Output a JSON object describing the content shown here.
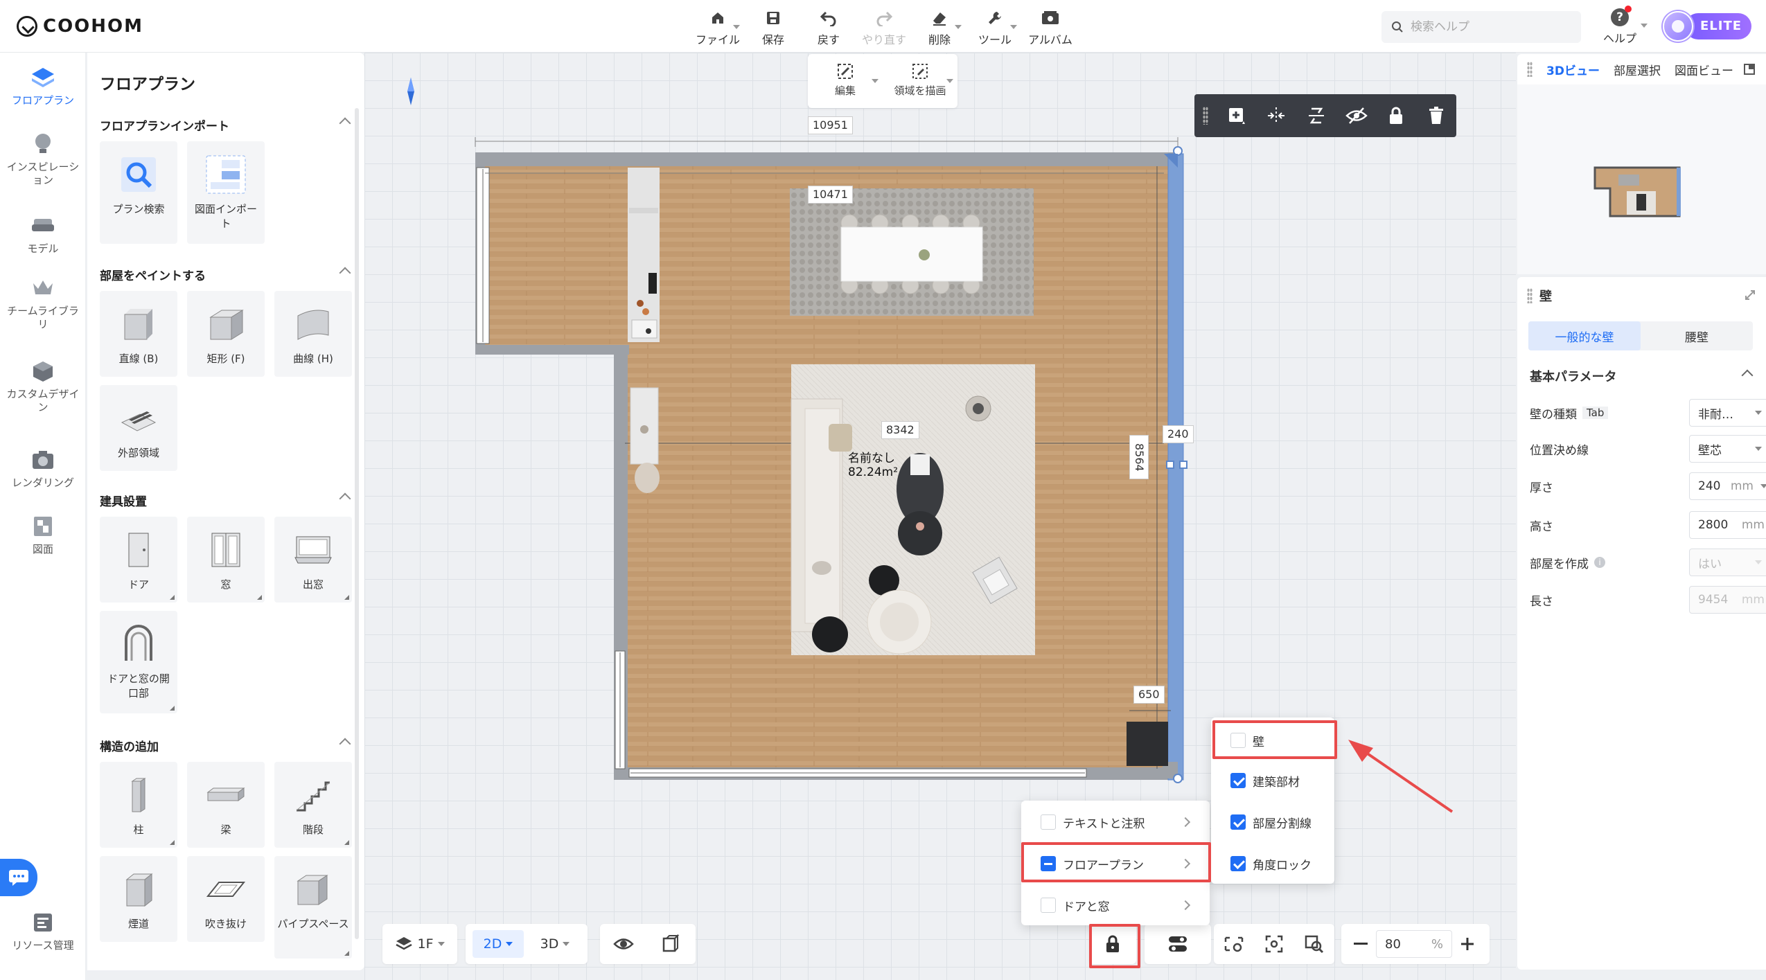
{
  "app": {
    "logo": "COOHOM"
  },
  "toolbar": {
    "file": "ファイル",
    "save": "保存",
    "undo": "戻す",
    "redo": "やり直す",
    "delete": "削除",
    "tools": "ツール",
    "album": "アルバム"
  },
  "search": {
    "placeholder": "検索ヘルプ"
  },
  "help": {
    "label": "ヘルプ"
  },
  "user": {
    "badge": "ELITE"
  },
  "leftnav": {
    "items": [
      {
        "label": "フロアプラン"
      },
      {
        "label": "インスピレーション"
      },
      {
        "label": "モデル"
      },
      {
        "label": "チームライブラリ"
      },
      {
        "label": "カスタムデザイン"
      },
      {
        "label": "レンダリング"
      },
      {
        "label": "図面"
      },
      {
        "label": "リソース管理"
      }
    ]
  },
  "panel": {
    "title": "フロアプラン",
    "sections": [
      {
        "title": "フロアプランインポート",
        "items": [
          {
            "label": "プラン検索"
          },
          {
            "label": "図面インポート"
          }
        ]
      },
      {
        "title": "部屋をペイントする",
        "items": [
          {
            "label": "直線 (B)"
          },
          {
            "label": "矩形 (F)"
          },
          {
            "label": "曲線 (H)"
          },
          {
            "label": "外部領域"
          }
        ]
      },
      {
        "title": "建具設置",
        "items": [
          {
            "label": "ドア"
          },
          {
            "label": "窓"
          },
          {
            "label": "出窓"
          },
          {
            "label": "ドアと窓の開口部"
          }
        ]
      },
      {
        "title": "構造の追加",
        "items": [
          {
            "label": "柱"
          },
          {
            "label": "梁"
          },
          {
            "label": "階段"
          },
          {
            "label": "煙道"
          },
          {
            "label": "吹き抜け"
          },
          {
            "label": "パイプスペース"
          }
        ]
      }
    ]
  },
  "canvas": {
    "draw_bar": {
      "edit": "編集",
      "draw_area": "領域を描画"
    },
    "dims": {
      "top_outer": "10951",
      "top_inner": "10471",
      "inner_mid": "8342",
      "right_height": "8564",
      "thickness": "240",
      "bottom_right": "650"
    },
    "room": {
      "name": "名前なし",
      "area": "82.24m²"
    }
  },
  "bottom": {
    "floor": "1F",
    "view2d": "2D",
    "view3d": "3D",
    "zoom": "80",
    "zoom_unit": "%"
  },
  "lock_menu": {
    "items": [
      {
        "label": "テキストと注釈",
        "state": "unchecked"
      },
      {
        "label": "フロアープラン",
        "state": "partial"
      },
      {
        "label": "ドアと窓",
        "state": "unchecked"
      }
    ]
  },
  "lock_submenu": {
    "items": [
      {
        "label": "壁",
        "state": "unchecked"
      },
      {
        "label": "建築部材",
        "state": "checked"
      },
      {
        "label": "部屋分割線",
        "state": "checked"
      },
      {
        "label": "角度ロック",
        "state": "checked"
      }
    ]
  },
  "right": {
    "tabs": [
      {
        "label": "3Dビュー"
      },
      {
        "label": "部屋選択"
      },
      {
        "label": "図面ビュー"
      }
    ],
    "props": {
      "title": "壁",
      "subtabs": [
        {
          "label": "一般的な壁"
        },
        {
          "label": "腰壁"
        }
      ],
      "section": "基本パラメータ",
      "rows": [
        {
          "label": "壁の種類",
          "key": "Tab",
          "value": "非耐…"
        },
        {
          "label": "位置決め線",
          "value": "壁芯"
        },
        {
          "label": "厚さ",
          "value": "240",
          "unit": "mm"
        },
        {
          "label": "高さ",
          "value": "2800",
          "unit": "mm"
        },
        {
          "label": "部屋を作成",
          "value": "はい"
        },
        {
          "label": "長さ",
          "value": "9454",
          "unit": "mm"
        }
      ]
    }
  },
  "colors": {
    "accent": "#1f6df4",
    "highlight": "#e84b4b",
    "wall_selected": "#7b9fd6",
    "floor_wood": "#c9a37a"
  }
}
